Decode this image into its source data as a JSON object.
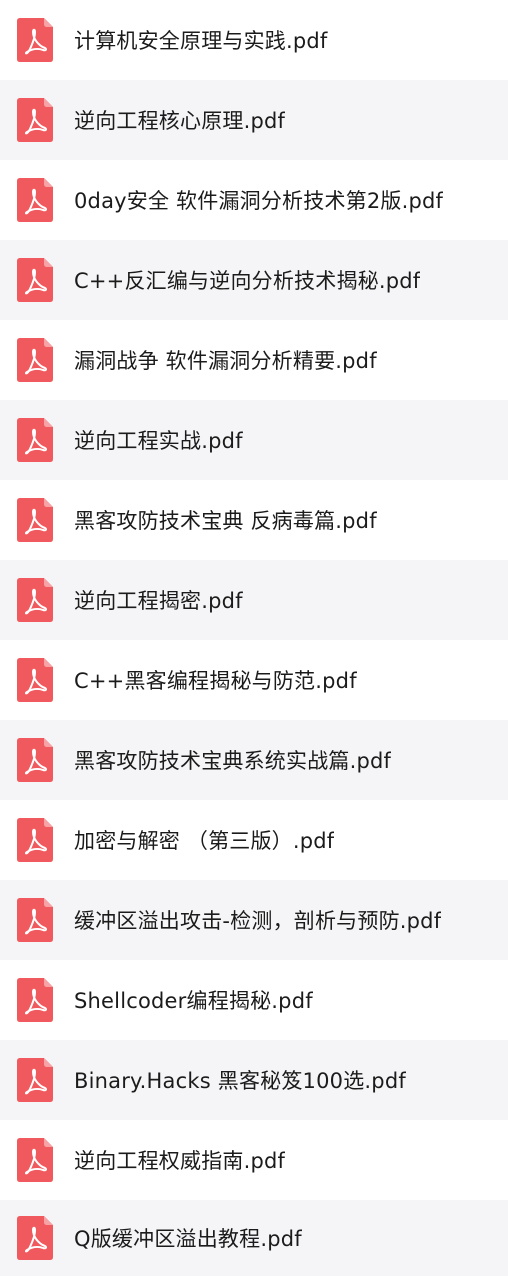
{
  "colors": {
    "pdf_icon": "#f0595d",
    "pdf_icon_fold": "#f7a3a5",
    "row_alt_background": "#f5f5f7",
    "text": "#1b1b1b"
  },
  "files": [
    {
      "name": "计算机安全原理与实践.pdf",
      "icon": "pdf-file-icon"
    },
    {
      "name": "逆向工程核心原理.pdf",
      "icon": "pdf-file-icon"
    },
    {
      "name": "0day安全 软件漏洞分析技术第2版.pdf",
      "icon": "pdf-file-icon"
    },
    {
      "name": "C++反汇编与逆向分析技术揭秘.pdf",
      "icon": "pdf-file-icon"
    },
    {
      "name": "漏洞战争  软件漏洞分析精要.pdf",
      "icon": "pdf-file-icon"
    },
    {
      "name": "逆向工程实战.pdf",
      "icon": "pdf-file-icon"
    },
    {
      "name": "黑客攻防技术宝典  反病毒篇.pdf",
      "icon": "pdf-file-icon"
    },
    {
      "name": "逆向工程揭密.pdf",
      "icon": "pdf-file-icon"
    },
    {
      "name": "C++黑客编程揭秘与防范.pdf",
      "icon": "pdf-file-icon"
    },
    {
      "name": "黑客攻防技术宝典系统实战篇.pdf",
      "icon": "pdf-file-icon"
    },
    {
      "name": "加密与解密  （第三版）.pdf",
      "icon": "pdf-file-icon"
    },
    {
      "name": "缓冲区溢出攻击-检测，剖析与预防.pdf",
      "icon": "pdf-file-icon"
    },
    {
      "name": "Shellcoder编程揭秘.pdf",
      "icon": "pdf-file-icon"
    },
    {
      "name": "Binary.Hacks 黑客秘笈100选.pdf",
      "icon": "pdf-file-icon"
    },
    {
      "name": "逆向工程权威指南.pdf",
      "icon": "pdf-file-icon"
    },
    {
      "name": "Q版缓冲区溢出教程.pdf",
      "icon": "pdf-file-icon"
    }
  ]
}
